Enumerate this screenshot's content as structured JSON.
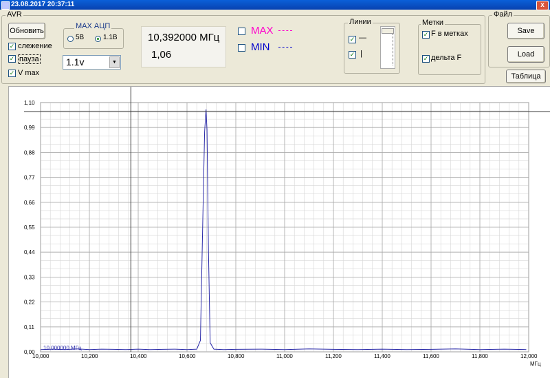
{
  "titlebar": {
    "text": "23.08.2017 20:37:11",
    "close": "x"
  },
  "avr": {
    "label": "AVR",
    "update_button": "Обновить",
    "check_tracking": "слежение",
    "check_pause": "пауза",
    "check_vmax": "V max",
    "check_mark": "✓"
  },
  "adc": {
    "label": "MAX АЦП",
    "opt1": "5В",
    "opt2": "1.1В",
    "selected": "1.1В"
  },
  "range_select": {
    "value": "1.1v"
  },
  "readout": {
    "freq": "10,392000 МГц",
    "level": "1,06"
  },
  "legend": {
    "max_label": "MAX",
    "min_label": "MIN",
    "max_color": "#ff00cc",
    "min_color": "#0000cc"
  },
  "lines": {
    "label": "Линии",
    "horiz": "—",
    "vert": "|"
  },
  "marks": {
    "label": "Метки",
    "f_in_marks": "F в метках",
    "delta_f": "дельта F"
  },
  "file": {
    "label": "Файл",
    "save": "Save",
    "load": "Load",
    "table": "Таблица"
  },
  "chart_data": {
    "type": "line",
    "ylim": [
      0,
      1.1
    ],
    "xlim": [
      10.0,
      12.0
    ],
    "y_ticks": [
      "1,10",
      "0,99",
      "0,88",
      "0,77",
      "0,66",
      "0,55",
      "0,44",
      "0,33",
      "0,22",
      "0,11",
      "0,00"
    ],
    "x_ticks": [
      "10,000",
      "10,200",
      "10,400",
      "10,600",
      "10,800",
      "11,000",
      "11,200",
      "11,400",
      "11,600",
      "11,800",
      "12,000"
    ],
    "xlabel": "МГц",
    "start_label": "10,000000 МГц",
    "cursor_x": 10.37,
    "cursor_y": 1.06,
    "series": [
      {
        "color": "#2a2aa8",
        "x": [
          10.0,
          10.05,
          10.1,
          10.15,
          10.2,
          10.25,
          10.3,
          10.35,
          10.4,
          10.45,
          10.5,
          10.55,
          10.6,
          10.64,
          10.655,
          10.665,
          10.672,
          10.678,
          10.682,
          10.688,
          10.695,
          10.71,
          10.75,
          10.8,
          10.9,
          11.0,
          11.1,
          11.2,
          11.3,
          11.4,
          11.5,
          11.6,
          11.7,
          11.8,
          11.9,
          11.99
        ],
        "y": [
          0.01,
          0.012,
          0.01,
          0.013,
          0.01,
          0.012,
          0.011,
          0.01,
          0.012,
          0.01,
          0.011,
          0.012,
          0.01,
          0.012,
          0.05,
          0.6,
          0.97,
          1.07,
          0.98,
          0.45,
          0.04,
          0.012,
          0.01,
          0.011,
          0.012,
          0.01,
          0.013,
          0.011,
          0.01,
          0.012,
          0.01,
          0.011,
          0.013,
          0.01,
          0.012,
          0.01
        ]
      }
    ]
  }
}
